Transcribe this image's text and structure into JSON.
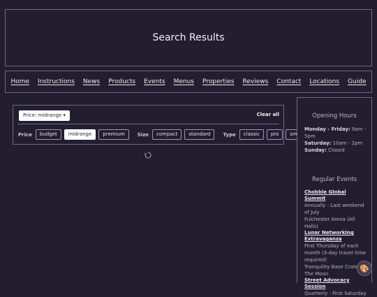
{
  "header": {
    "title": "Search Results"
  },
  "nav": {
    "links": [
      "Home",
      "Instructions",
      "News",
      "Products",
      "Events",
      "Menus",
      "Properties",
      "Reviews",
      "Contact",
      "Locations",
      "Guide"
    ]
  },
  "filters": {
    "active_chip": "Price: midrange ▾",
    "clear_all": "Clear all",
    "groups": [
      {
        "label": "Price",
        "options": [
          "budget",
          "midrange",
          "premium"
        ],
        "selected": "midrange"
      },
      {
        "label": "Size",
        "options": [
          "compact",
          "standard"
        ]
      },
      {
        "label": "Type",
        "options": [
          "classic",
          "pro",
          "smart"
        ]
      }
    ]
  },
  "sidebar": {
    "hours_title": "Opening Hours",
    "hours": [
      {
        "days": "Monday - Friday:",
        "time": "9am - 5pm"
      },
      {
        "days": "Saturday:",
        "time": "10am - 2pm"
      },
      {
        "days": "Sunday:",
        "time": "Closed"
      }
    ],
    "events_title": "Regular Events",
    "events": [
      {
        "name": "Chobble Global Summit",
        "when": "Annually - Last weekend of July",
        "where": "Fulchester Arena (All Halls)"
      },
      {
        "name": "Lunar Networking Extravaganza",
        "when": "First Thursday of each month (3-day travel time required)",
        "where": "Tranquility Base Crater, The Moon"
      },
      {
        "name": "Street Advocacy Session",
        "when": "Quarterly - First Saturday",
        "where": ""
      }
    ]
  },
  "fab": {
    "icon": "palette-icon"
  }
}
